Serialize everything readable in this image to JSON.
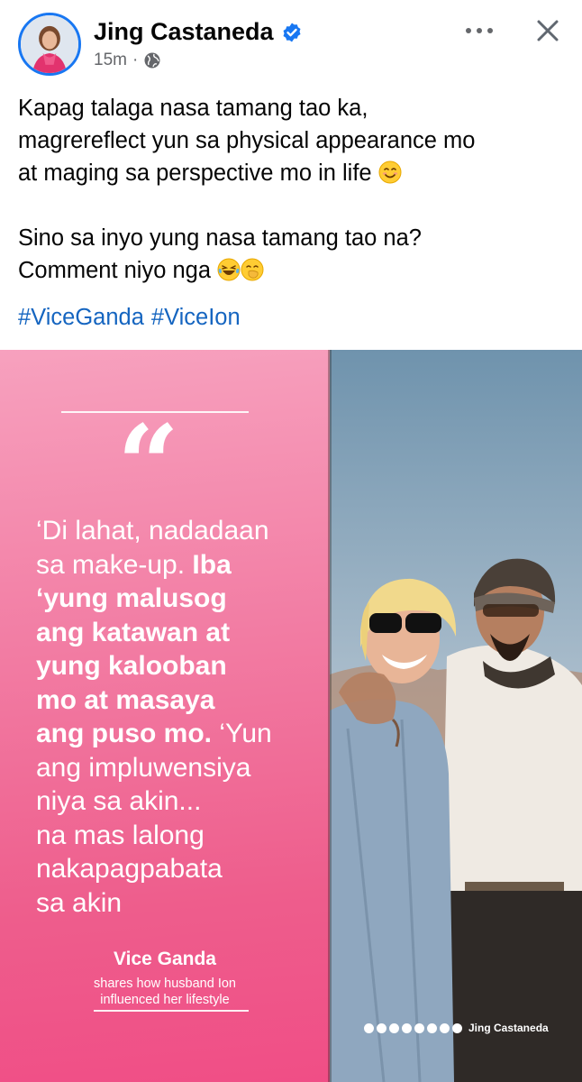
{
  "header": {
    "author_name": "Jing Castaneda",
    "timestamp": "15m",
    "separator": "·",
    "verified_icon": "verified-badge-icon",
    "privacy_icon": "globe-icon",
    "more_icon": "more-horizontal-icon",
    "close_icon": "close-icon"
  },
  "post": {
    "line1": "Kapag talaga nasa tamang tao ka,",
    "line2": "magrereflect yun sa physical appearance mo",
    "line3": "at maging sa perspective mo in life",
    "line4": "Sino sa inyo yung nasa tamang tao na?",
    "line5": "Comment niyo nga",
    "hashtags": [
      "#ViceGanda",
      "#ViceIon"
    ]
  },
  "image": {
    "quote_mark": "“",
    "quote_lines": [
      {
        "text": "‘Di lahat, nadadaan",
        "bold": false
      },
      {
        "text": "sa make-up. ",
        "bold": false,
        "tail": "Iba",
        "tail_bold": true
      },
      {
        "text": "‘yung malusog",
        "bold": true
      },
      {
        "text": "ang katawan at",
        "bold": true
      },
      {
        "text": "yung kalooban",
        "bold": true
      },
      {
        "text": "mo at masaya",
        "bold": true
      },
      {
        "text": "ang puso mo.",
        "bold": true,
        "tail": " ‘Yun",
        "tail_bold": false
      },
      {
        "text": "ang impluwensiya",
        "bold": false
      },
      {
        "text": "niya sa akin...",
        "bold": false
      },
      {
        "text": "na mas lalong",
        "bold": false
      },
      {
        "text": "nakapagpabata",
        "bold": false
      },
      {
        "text": "sa akin",
        "bold": false
      }
    ],
    "attribution_name": "Vice Ganda",
    "attribution_sub1": "shares how husband Ion",
    "attribution_sub2": "influenced her lifestyle",
    "credit_text": "Jing Castaneda"
  },
  "colors": {
    "accent": "#1877f2",
    "hashtag": "#1565c0",
    "pink_top": "#f7a1be",
    "pink_bottom": "#f04e86"
  }
}
